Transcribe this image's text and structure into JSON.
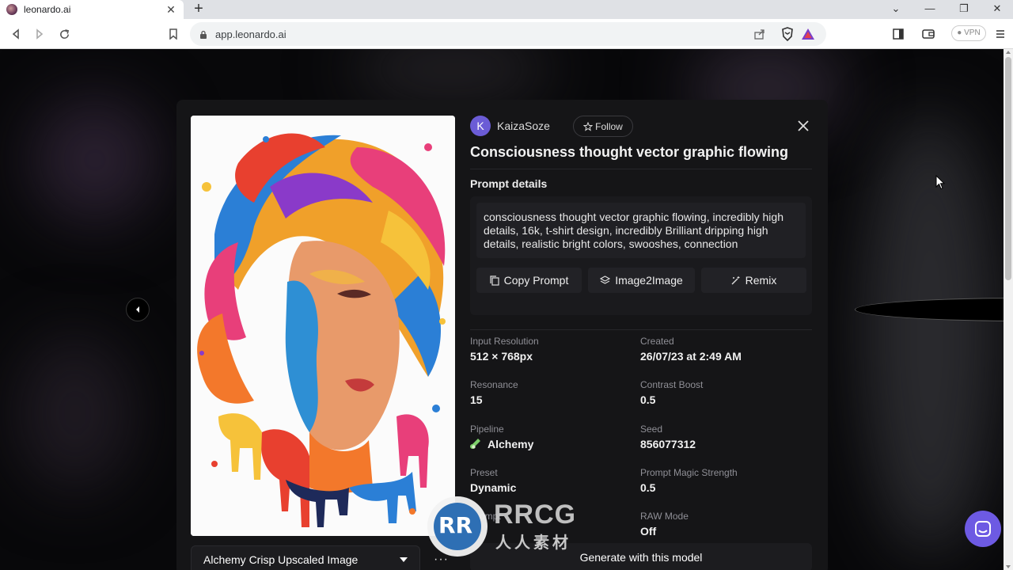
{
  "browser": {
    "tab_title": "leonardo.ai",
    "url": "app.leonardo.ai",
    "vpn_label": "● VPN",
    "new_tab": "+",
    "tab_close": "✕"
  },
  "modal": {
    "username": "KaizaSoze",
    "avatar_letter": "K",
    "follow_label": "Follow",
    "title": "Consciousness thought vector graphic flowing",
    "prompt_details_label": "Prompt details",
    "prompt": "consciousness thought vector graphic flowing, incredibly high details, 16k, t-shirt design, incredibly Brilliant dripping high details, realistic bright colors, swooshes, connection",
    "buttons": {
      "copy": "Copy Prompt",
      "img2img": "Image2Image",
      "remix": "Remix"
    },
    "meta": [
      {
        "label": "Input Resolution",
        "value": "512 × 768px"
      },
      {
        "label": "Created",
        "value": "26/07/23 at 2:49 AM"
      },
      {
        "label": "Resonance",
        "value": "15"
      },
      {
        "label": "Contrast Boost",
        "value": "0.5"
      },
      {
        "label": "Pipeline",
        "value": "Alchemy"
      },
      {
        "label": "Seed",
        "value": "856077312"
      },
      {
        "label": "Preset",
        "value": "Dynamic"
      },
      {
        "label": "Prompt Magic Strength",
        "value": "0.5"
      },
      {
        "label": "Prompt",
        "value": ""
      },
      {
        "label": "RAW Mode",
        "value": "Off"
      }
    ],
    "upscale_select": "Alchemy Crisp Upscaled Image",
    "more": "···",
    "generate_label": "Generate with this model"
  },
  "watermark": {
    "mark": "RR",
    "big": "RRCG",
    "small": "人人素材"
  },
  "colors": {
    "accent": "#6d5ae3",
    "modal_bg": "#151517",
    "page_bg": "#08080a"
  }
}
